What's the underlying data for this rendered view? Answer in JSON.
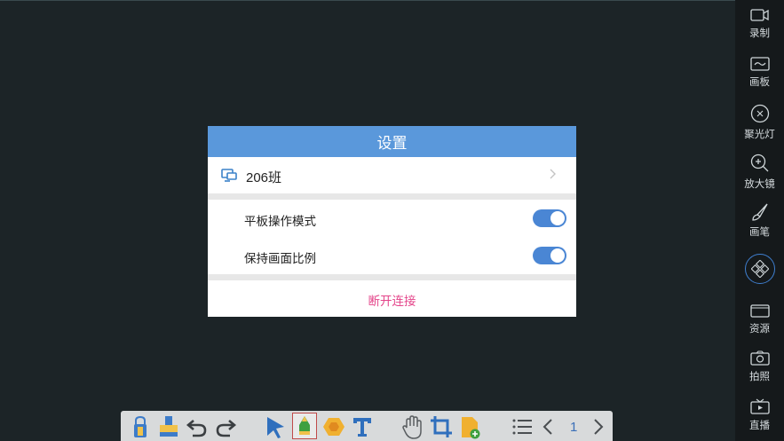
{
  "dialog": {
    "title": "设置",
    "class_name": "206班",
    "options": [
      {
        "label": "平板操作模式",
        "on": true
      },
      {
        "label": "保持画面比例",
        "on": true
      }
    ],
    "disconnect_label": "断开连接"
  },
  "sidebar": {
    "items": [
      {
        "label": "录制",
        "icon": "video-camera-icon"
      },
      {
        "label": "画板",
        "icon": "whiteboard-icon"
      },
      {
        "label": "聚光灯",
        "icon": "spotlight-icon"
      },
      {
        "label": "放大镜",
        "icon": "magnifier-icon"
      },
      {
        "label": "画笔",
        "icon": "brush-icon"
      },
      {
        "label": "",
        "icon": "center-tools-icon"
      },
      {
        "label": "资源",
        "icon": "folder-icon"
      },
      {
        "label": "拍照",
        "icon": "camera-icon"
      },
      {
        "label": "直播",
        "icon": "live-tv-icon"
      }
    ]
  },
  "toolbar": {
    "page_number": "1"
  },
  "colors": {
    "accent": "#5a98db",
    "toggle": "#4a86d4",
    "danger": "#e4458a",
    "background": "#1c2427",
    "sidebar": "#15191b"
  }
}
